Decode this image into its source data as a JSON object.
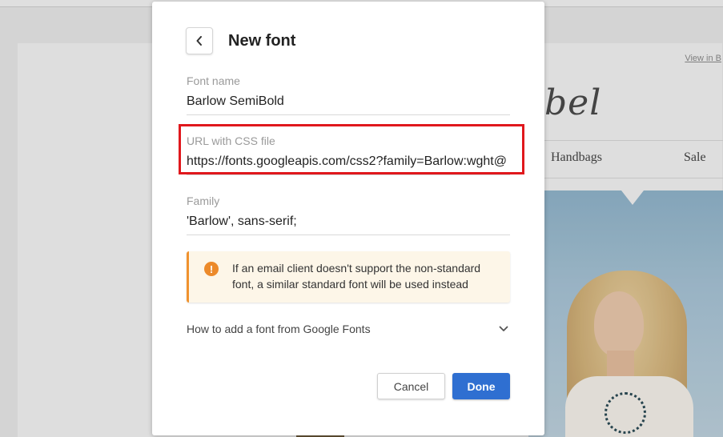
{
  "background": {
    "view_link": "View in B",
    "logo_text": "bel",
    "nav_items": [
      "Handbags",
      "Sale"
    ]
  },
  "modal": {
    "title": "New font",
    "fields": {
      "font_name": {
        "label": "Font name",
        "value": "Barlow SemiBold"
      },
      "css_url": {
        "label": "URL with CSS file",
        "value": "https://fonts.googleapis.com/css2?family=Barlow:wght@"
      },
      "family": {
        "label": "Family",
        "value": "'Barlow', sans-serif;"
      }
    },
    "notice": {
      "icon": "exclamation-icon",
      "text": "If an email client doesn't support the non-standard font, a similar standard font will be used instead"
    },
    "accordion": {
      "label": "How to add a font from Google Fonts"
    },
    "buttons": {
      "cancel": "Cancel",
      "done": "Done"
    }
  },
  "colors": {
    "primary": "#2f6fd1",
    "highlight_border": "#e0181d",
    "notice_accent": "#f0922e",
    "notice_bg": "#fdf6e8"
  }
}
